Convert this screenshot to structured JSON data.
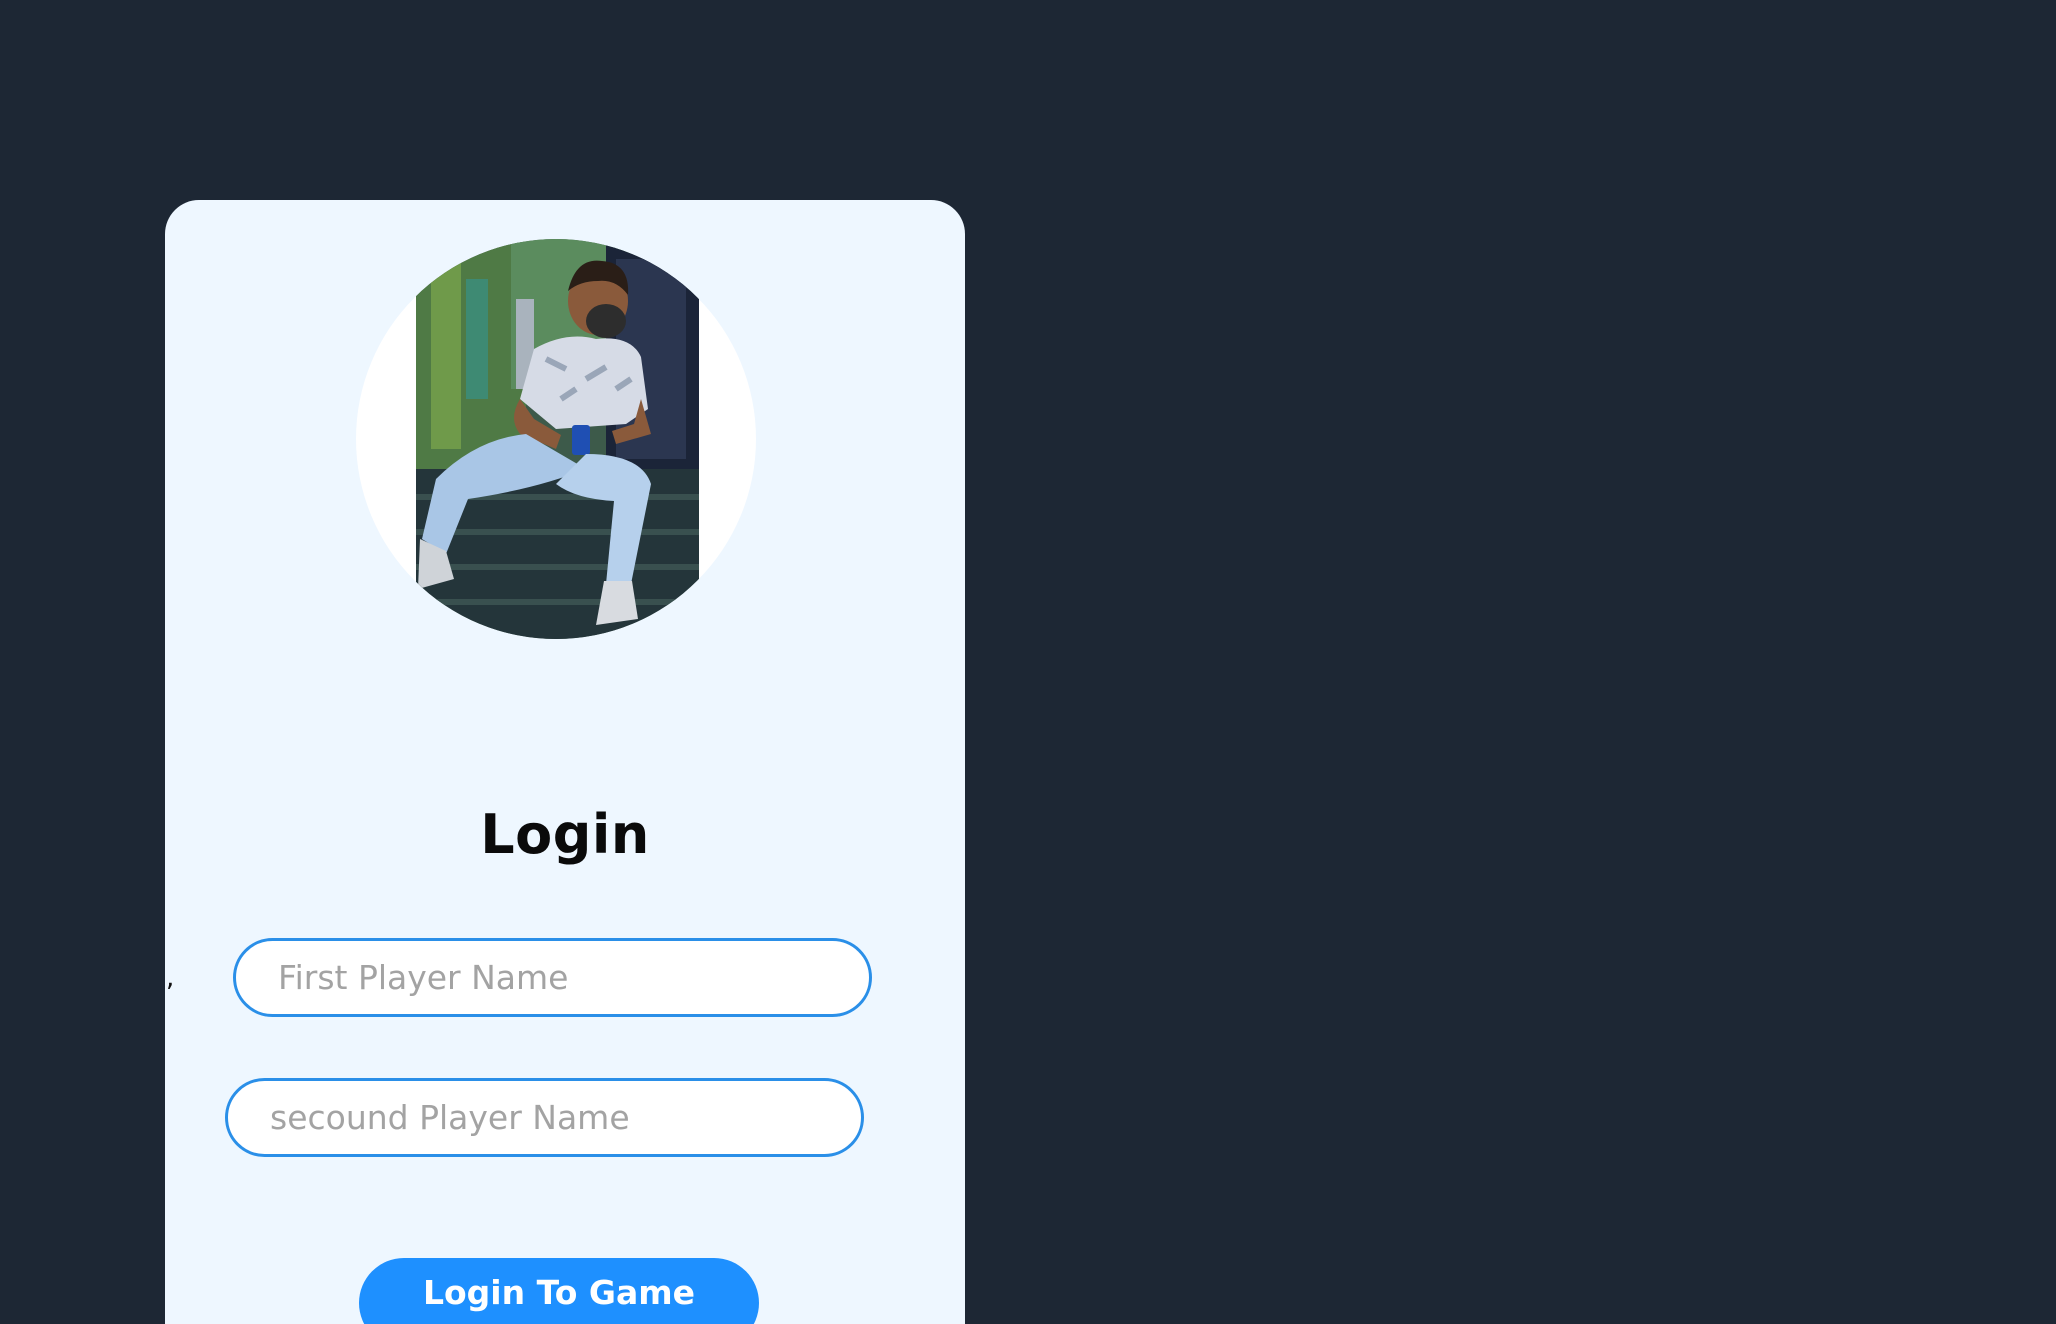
{
  "login": {
    "title": "Login",
    "stray_mark": ",",
    "first_player": {
      "placeholder": "First Player Name",
      "value": ""
    },
    "second_player": {
      "placeholder": "secound Player Name",
      "value": ""
    },
    "submit_label": "Login To Game"
  },
  "avatar": {
    "icon": "profile-photo"
  },
  "colors": {
    "page_background": "#1d2734",
    "card_background": "#eef7ff",
    "accent": "#1e90ff",
    "input_border": "#2a8fe8",
    "title_text": "#0a0a0a",
    "placeholder_text": "#a3a3a3"
  }
}
